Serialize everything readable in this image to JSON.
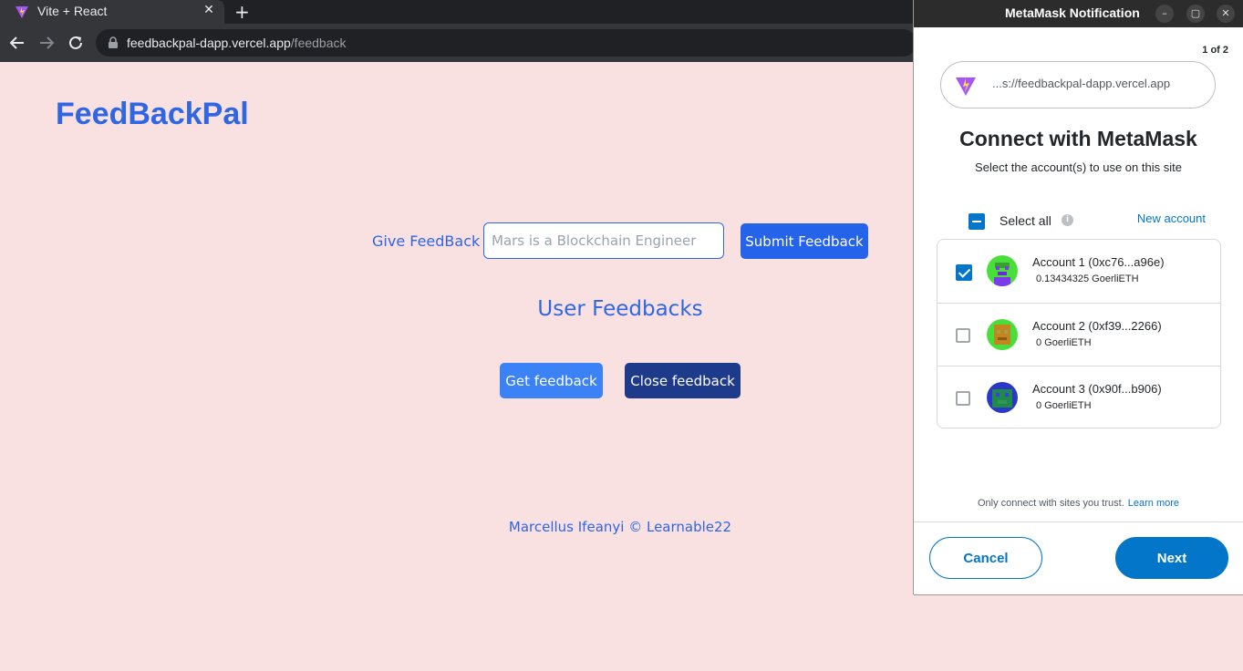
{
  "browser": {
    "tab_title": "Vite + React",
    "tab_close": "✕",
    "new_tab": "+",
    "url_host": "feedbackpal-dapp.vercel.app",
    "url_path": "/feedback"
  },
  "page": {
    "logo": "FeedBackPal",
    "give_feedback_label": "Give FeedBack",
    "feedback_input_placeholder": "Mars is a Blockchain Engineer",
    "submit_button": "Submit Feedback",
    "feedbacks_heading": "User Feedbacks",
    "get_button": "Get feedback",
    "close_button": "Close feedback",
    "footer": "Marcellus Ifeanyi © Learnable22"
  },
  "metamask": {
    "window_title": "MetaMask Notification",
    "window_buttons": [
      "–",
      "▢",
      "✕"
    ],
    "pager": "1 of 2",
    "site_url": "...s://feedbackpal-dapp.vercel.app",
    "heading": "Connect with MetaMask",
    "subheading": "Select the account(s) to use on this site",
    "select_all": "Select all",
    "info": "i",
    "new_account": "New account",
    "accounts": [
      {
        "name": "Account 1 (0xc76...a96e)",
        "balance": "0.13434325 GoerliETH",
        "checked": true
      },
      {
        "name": "Account 2 (0xf39...2266)",
        "balance": "0 GoerliETH",
        "checked": false
      },
      {
        "name": "Account 3 (0x90f...b906)",
        "balance": "0 GoerliETH",
        "checked": false
      }
    ],
    "trust_text": "Only connect with sites you trust.",
    "learn_more": "Learn more",
    "cancel_button": "Cancel",
    "next_button": "Next",
    "accent_color": "#0376c9"
  },
  "colors": {
    "page_bg": "#f9e0e1",
    "brand_blue": "#2f66e3"
  }
}
